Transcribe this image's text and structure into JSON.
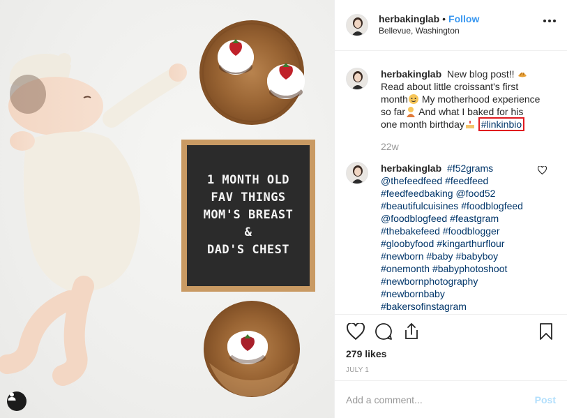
{
  "post": {
    "photo_text": [
      "1 MONTH OLD",
      "FAV THINGS",
      "MOM'S BREAST",
      "&",
      "DAD'S CHEST"
    ]
  },
  "header": {
    "username": "herbakinglab",
    "dot": "•",
    "follow_label": "Follow",
    "location": "Bellevue, Washington"
  },
  "caption": {
    "username": "herbakinglab",
    "text_1": "New blog post!!",
    "text_2": "Read about little croissant's first month",
    "text_3": "My motherhood experience so far",
    "text_4": "And what I baked for his one month birthday",
    "hashtag": "#linkinbio",
    "time": "22w"
  },
  "comment": {
    "username": "herbakinglab",
    "tags": [
      "#f52grams",
      "@thefeedfeed",
      "#feedfeed",
      "#feedfeedbaking",
      "@food52",
      "#beautifulcuisines",
      "#foodblogfeed",
      "@foodblogfeed",
      "#feastgram",
      "#thebakefeed",
      "#foodblogger",
      "#gloobyfood",
      "#kingarthurflour",
      "#newborn",
      "#baby",
      "#babyboy",
      "#onemonth",
      "#babyphotoshoot",
      "#newbornphotography",
      "#newbornbaby",
      "#bakersofinstagram"
    ]
  },
  "icons": [
    "heart-icon",
    "comment-icon",
    "share-icon",
    "bookmark-icon",
    "more-icon",
    "user-tag-icon"
  ],
  "likes": "279 likes",
  "date": "JULY 1",
  "add_comment": {
    "placeholder": "Add a comment...",
    "post_label": "Post"
  },
  "colors": {
    "link": "#3897f0",
    "hashtag": "#003569",
    "highlight": "#e0191f",
    "post_disabled": "#b2dffc"
  }
}
